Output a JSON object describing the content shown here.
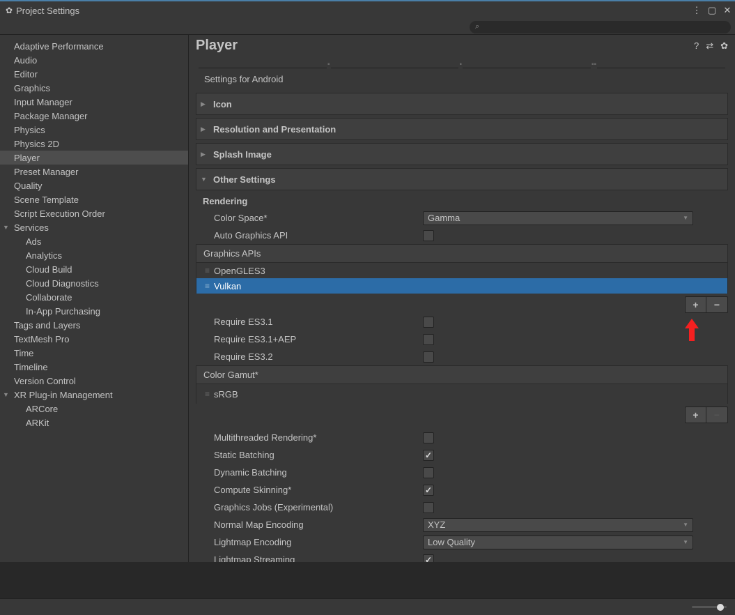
{
  "window": {
    "title": "Project Settings"
  },
  "sidebar": {
    "items": [
      {
        "label": "Adaptive Performance"
      },
      {
        "label": "Audio"
      },
      {
        "label": "Editor"
      },
      {
        "label": "Graphics"
      },
      {
        "label": "Input Manager"
      },
      {
        "label": "Package Manager"
      },
      {
        "label": "Physics"
      },
      {
        "label": "Physics 2D"
      },
      {
        "label": "Player",
        "selected": true
      },
      {
        "label": "Preset Manager"
      },
      {
        "label": "Quality"
      },
      {
        "label": "Scene Template"
      },
      {
        "label": "Script Execution Order"
      },
      {
        "label": "Services",
        "expanded": true,
        "children": [
          {
            "label": "Ads"
          },
          {
            "label": "Analytics"
          },
          {
            "label": "Cloud Build"
          },
          {
            "label": "Cloud Diagnostics"
          },
          {
            "label": "Collaborate"
          },
          {
            "label": "In-App Purchasing"
          }
        ]
      },
      {
        "label": "Tags and Layers"
      },
      {
        "label": "TextMesh Pro"
      },
      {
        "label": "Time"
      },
      {
        "label": "Timeline"
      },
      {
        "label": "Version Control"
      },
      {
        "label": "XR Plug-in Management",
        "expanded": true,
        "children": [
          {
            "label": "ARCore"
          },
          {
            "label": "ARKit"
          }
        ]
      }
    ]
  },
  "content": {
    "title": "Player",
    "settingsFor": "Settings for Android",
    "sections": {
      "icon": "Icon",
      "resolution": "Resolution and Presentation",
      "splash": "Splash Image",
      "other": "Other Settings"
    },
    "rendering": {
      "heading": "Rendering",
      "colorSpaceLabel": "Color Space*",
      "colorSpaceValue": "Gamma",
      "autoGraphicsLabel": "Auto Graphics API",
      "graphicsApisHeader": "Graphics APIs",
      "apis": [
        {
          "label": "OpenGLES3"
        },
        {
          "label": "Vulkan",
          "selected": true
        }
      ],
      "requireES31Label": "Require ES3.1",
      "requireES31AEPLabel": "Require ES3.1+AEP",
      "requireES32Label": "Require ES3.2",
      "colorGamutHeader": "Color Gamut*",
      "gamuts": [
        {
          "label": "sRGB"
        }
      ],
      "multithreadedLabel": "Multithreaded Rendering*",
      "staticBatchingLabel": "Static Batching",
      "dynamicBatchingLabel": "Dynamic Batching",
      "computeSkinningLabel": "Compute Skinning*",
      "graphicsJobsLabel": "Graphics Jobs (Experimental)",
      "normalMapLabel": "Normal Map Encoding",
      "normalMapValue": "XYZ",
      "lightmapEncLabel": "Lightmap Encoding",
      "lightmapEncValue": "Low Quality",
      "lightmapStreamLabel": "Lightmap Streaming"
    }
  }
}
